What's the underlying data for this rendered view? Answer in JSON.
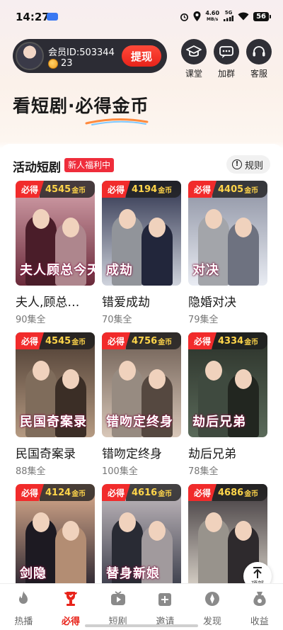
{
  "status_bar": {
    "time": "14:27",
    "net_speed": "4.60",
    "net_unit": "MB/s",
    "signal_label": "5G",
    "battery": "56"
  },
  "member": {
    "id_label": "会员ID:503344",
    "coins": "23",
    "withdraw_label": "提现"
  },
  "top_actions": [
    {
      "label": "课堂",
      "icon": "graduation-cap-icon"
    },
    {
      "label": "加群",
      "icon": "chat-group-icon"
    },
    {
      "label": "客服",
      "icon": "headset-icon"
    }
  ],
  "banner": {
    "title": "看短剧·必得金币"
  },
  "section": {
    "title": "活动短剧",
    "badge": "新人福利中",
    "rules_label": "规则"
  },
  "reward_tag": "必得",
  "coin_unit": "金币",
  "dramas": [
    {
      "name": "夫人,顾总…",
      "episodes": "90集全",
      "coins": "4545",
      "poster_text": "夫人顾总今天又吃醋了",
      "bg": "#6a2a3a",
      "accent": "#d9a7b0"
    },
    {
      "name": "错爱成劫",
      "episodes": "70集全",
      "coins": "4194",
      "poster_text": "成劫",
      "bg": "#cfd3dc",
      "accent": "#2a2f4a"
    },
    {
      "name": "隐婚对决",
      "episodes": "79集全",
      "coins": "4405",
      "poster_text": "对决",
      "bg": "#e9ecf3",
      "accent": "#8a8fa0"
    },
    {
      "name": "民国奇案录",
      "episodes": "88集全",
      "coins": "4545",
      "poster_text": "民国奇案录",
      "bg": "#b59a82",
      "accent": "#4a3a30"
    },
    {
      "name": "错吻定终身",
      "episodes": "100集全",
      "coins": "4756",
      "poster_text": "错吻定终身",
      "bg": "#d8c7b8",
      "accent": "#6a5a50"
    },
    {
      "name": "劫后兄弟",
      "episodes": "78集全",
      "coins": "4334",
      "poster_text": "劫后兄弟",
      "bg": "#5a6a5a",
      "accent": "#2a3028"
    },
    {
      "name": "",
      "episodes": "",
      "coins": "4124",
      "poster_text": "剑隐",
      "bg": "#2a2530",
      "accent": "#e0b090"
    },
    {
      "name": "",
      "episodes": "",
      "coins": "4616",
      "poster_text": "替身新娘",
      "bg": "#3a3d4a",
      "accent": "#c9c0c4"
    },
    {
      "name": "",
      "episodes": "",
      "coins": "4686",
      "poster_text": "",
      "bg": "#d9d2c8",
      "accent": "#3a3438"
    }
  ],
  "scroll_top_label": "顶部",
  "bottom_nav": [
    {
      "label": "热播",
      "icon": "flame-icon",
      "active": false
    },
    {
      "label": "必得",
      "icon": "trophy-icon",
      "active": true
    },
    {
      "label": "短剧",
      "icon": "tv-play-icon",
      "active": false
    },
    {
      "label": "邀请",
      "icon": "gift-plus-icon",
      "active": false
    },
    {
      "label": "发现",
      "icon": "compass-icon",
      "active": false
    },
    {
      "label": "收益",
      "icon": "coin-bag-icon",
      "active": false
    }
  ],
  "colors": {
    "accent_red": "#e8231a",
    "coin_gold": "#ffd54a",
    "dark_pill": "#2c2c34"
  }
}
